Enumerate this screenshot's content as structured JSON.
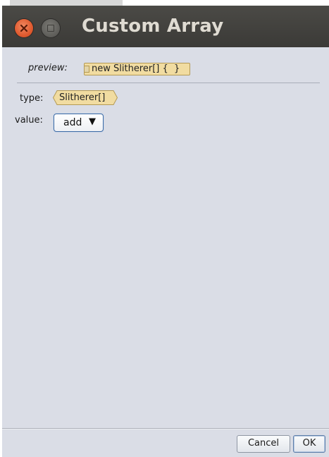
{
  "window": {
    "title": "Custom Array",
    "controls": {
      "close_icon": "close-icon",
      "maximize_icon": "maximize-icon"
    }
  },
  "preview": {
    "label": "preview:",
    "code": "new Slitherer[] {  }"
  },
  "fields": {
    "type_label": "type:",
    "type_value": "Slitherer[]",
    "value_label": "value:",
    "add_label": "add",
    "add_arrow": "▼"
  },
  "footer": {
    "cancel_label": "Cancel",
    "ok_label": "OK"
  },
  "colors": {
    "titlebar": "#3f3e3b",
    "close": "#e05a2f",
    "background": "#dadde6",
    "code_block": "#f1dca1",
    "accent": "#3e6ba5"
  }
}
